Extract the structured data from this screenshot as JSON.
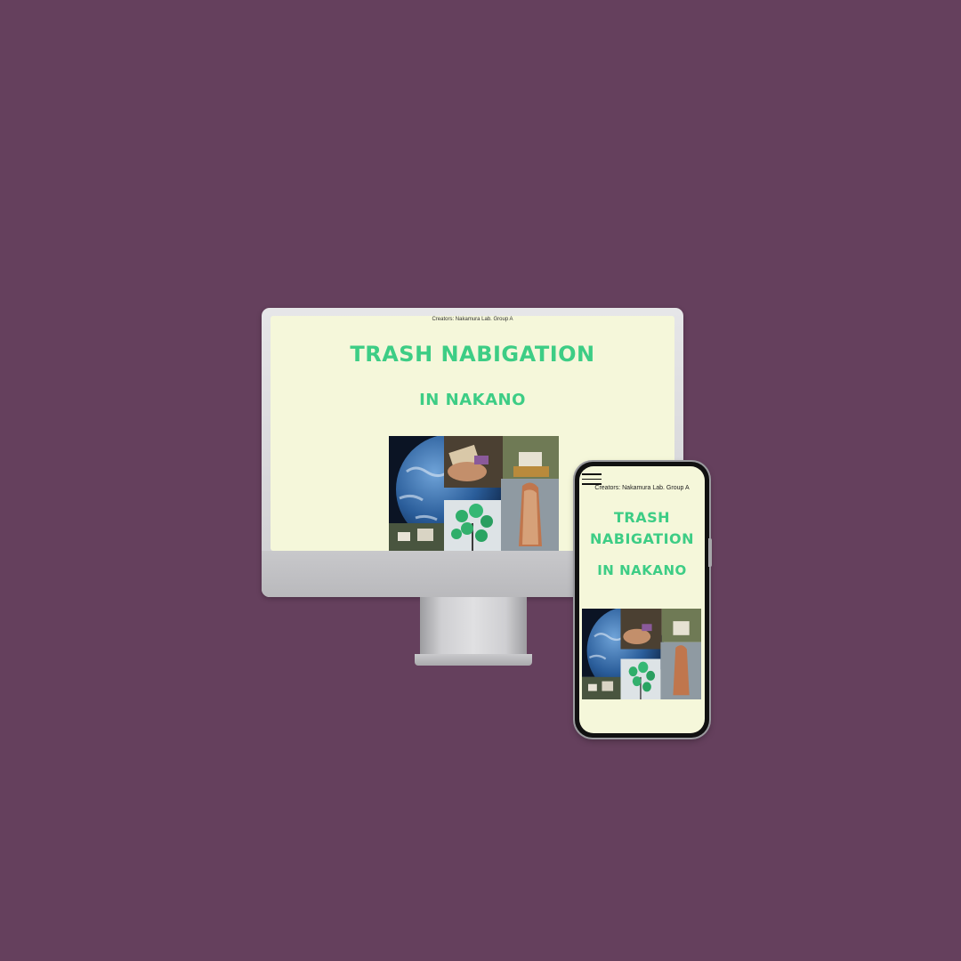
{
  "colors": {
    "background": "#65405d",
    "screen": "#f5f7da",
    "accent": "#3dcd85"
  },
  "desktop": {
    "creators": "Creators: Nakamura Lab. Group A",
    "title": "TRASH NABIGATION",
    "subtitle": "IN NAKANO"
  },
  "mobile": {
    "creators": "Creators: Nakamura Lab. Group A",
    "title_line1": "TRASH",
    "title_line2": "NABIGATION",
    "subtitle": "IN NAKANO",
    "menu_icon": "hamburger-menu-icon"
  },
  "collage": {
    "tiles": [
      "earth",
      "hand-with-trash",
      "trees-and-buildings",
      "green-bag-tree",
      "colorful-tower",
      "town-street"
    ]
  }
}
